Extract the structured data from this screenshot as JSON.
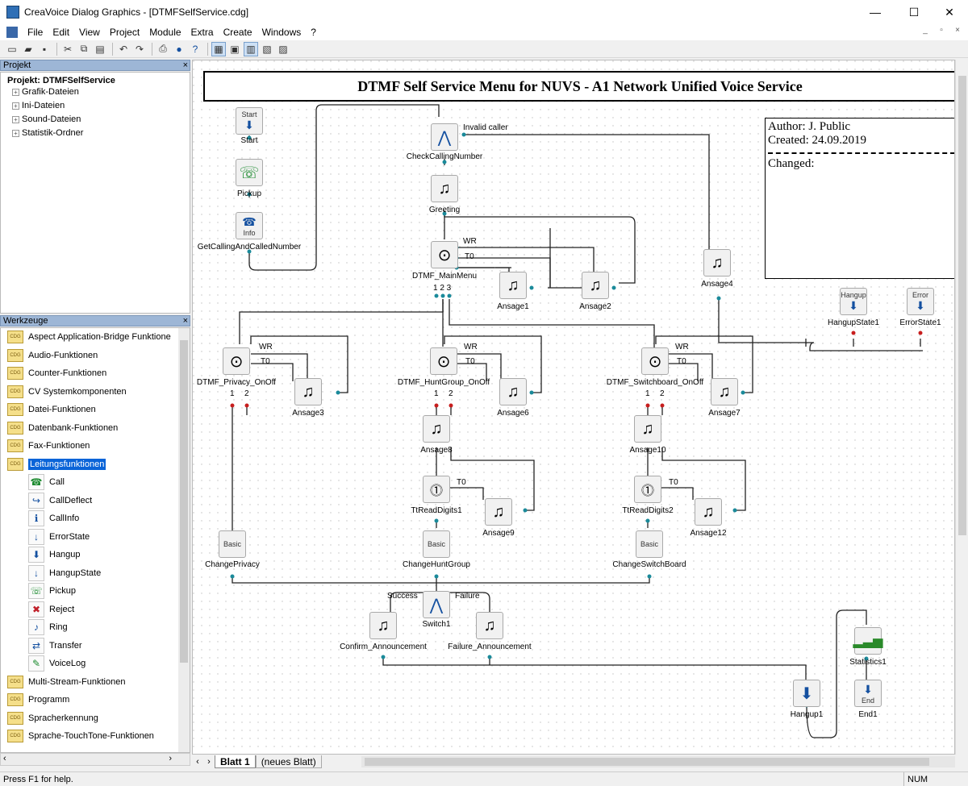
{
  "window": {
    "title": "CreaVoice Dialog Graphics - [DTMFSelfService.cdg]",
    "controls": [
      "—",
      "☐",
      "✕"
    ]
  },
  "menu": [
    "File",
    "Edit",
    "View",
    "Project",
    "Module",
    "Extra",
    "Create",
    "Windows",
    "?"
  ],
  "project_pane": {
    "title": "Projekt",
    "root": "Projekt: DTMFSelfService",
    "items": [
      "Grafik-Dateien",
      "Ini-Dateien",
      "Sound-Dateien",
      "Statistik-Ordner"
    ]
  },
  "tools_pane": {
    "title": "Werkzeuge",
    "groups_top": [
      "Aspect Application-Bridge Funktione",
      "Audio-Funktionen",
      "Counter-Funktionen",
      "CV Systemkomponenten",
      "Datei-Funktionen",
      "Datenbank-Funktionen",
      "Fax-Funktionen"
    ],
    "selected_group": "Leitungsfunktionen",
    "sub_items": [
      {
        "label": "Call",
        "icon": "call-icon"
      },
      {
        "label": "CallDeflect",
        "icon": "call-deflect-icon"
      },
      {
        "label": "CallInfo",
        "icon": "call-info-icon"
      },
      {
        "label": "ErrorState",
        "icon": "error-state-icon"
      },
      {
        "label": "Hangup",
        "icon": "hangup-icon"
      },
      {
        "label": "HangupState",
        "icon": "hangup-state-icon"
      },
      {
        "label": "Pickup",
        "icon": "pickup-icon"
      },
      {
        "label": "Reject",
        "icon": "reject-icon"
      },
      {
        "label": "Ring",
        "icon": "ring-icon"
      },
      {
        "label": "Transfer",
        "icon": "transfer-icon"
      },
      {
        "label": "VoiceLog",
        "icon": "voicelog-icon"
      }
    ],
    "groups_bottom": [
      "Multi-Stream-Funktionen",
      "Programm",
      "Spracherkennung",
      "Sprache-TouchTone-Funktionen"
    ]
  },
  "canvas": {
    "title": "DTMF Self Service Menu for NUVS - A1 Network Unified Voice Service",
    "author_line": "Author: J. Public",
    "created_line": "Created: 24.09.2019",
    "changed_line": "Changed:",
    "nodes": [
      {
        "id": "start",
        "label": "Start",
        "icon": "Start"
      },
      {
        "id": "pickup",
        "label": "Pickup"
      },
      {
        "id": "getcalling",
        "label": "GetCallingAndCalledNumber",
        "icon": "Info"
      },
      {
        "id": "checkcalling",
        "label": "CheckCallingNumber"
      },
      {
        "id": "greeting",
        "label": "Greeting"
      },
      {
        "id": "mainmenu",
        "label": "DTMF_MainMenu"
      },
      {
        "id": "ansage1",
        "label": "Ansage1"
      },
      {
        "id": "ansage2",
        "label": "Ansage2"
      },
      {
        "id": "ansage4",
        "label": "Ansage4"
      },
      {
        "id": "hangupstate1",
        "label": "HangupState1",
        "icon": "Hangup"
      },
      {
        "id": "errorstate1",
        "label": "ErrorState1",
        "icon": "Error"
      },
      {
        "id": "privacy",
        "label": "DTMF_Privacy_OnOff"
      },
      {
        "id": "ansage3",
        "label": "Ansage3"
      },
      {
        "id": "huntgroup",
        "label": "DTMF_HuntGroup_OnOff"
      },
      {
        "id": "ansage6",
        "label": "Ansage6"
      },
      {
        "id": "switchboard",
        "label": "DTMF_Switchboard_OnOff"
      },
      {
        "id": "ansage7",
        "label": "Ansage7"
      },
      {
        "id": "ansage8",
        "label": "Ansage8"
      },
      {
        "id": "ansage10",
        "label": "Ansage10"
      },
      {
        "id": "ttread1",
        "label": "TtReadDigits1"
      },
      {
        "id": "ansage9",
        "label": "Ansage9"
      },
      {
        "id": "ttread2",
        "label": "TtReadDigits2"
      },
      {
        "id": "ansage12",
        "label": "Ansage12"
      },
      {
        "id": "changeprivacy",
        "label": "ChangePrivacy",
        "icon": "Basic"
      },
      {
        "id": "changehunt",
        "label": "ChangeHuntGroup",
        "icon": "Basic"
      },
      {
        "id": "changeswitch",
        "label": "ChangeSwitchBoard",
        "icon": "Basic"
      },
      {
        "id": "switch1",
        "label": "Switch1"
      },
      {
        "id": "confirm",
        "label": "Confirm_Announcement"
      },
      {
        "id": "failure",
        "label": "Failure_Announcement"
      },
      {
        "id": "statistics1",
        "label": "Statistics1"
      },
      {
        "id": "hangup1",
        "label": "Hangup1"
      },
      {
        "id": "end1",
        "label": "End1",
        "icon": "End"
      }
    ],
    "port_labels": {
      "invalid_caller": "Invalid caller",
      "wr": "WR",
      "t0": "T0",
      "main_digits": "1 2 3",
      "one": "1",
      "two": "2",
      "success": "Success",
      "failure": "Failure"
    }
  },
  "tabs": {
    "active": "Blatt 1",
    "new": "(neues Blatt)"
  },
  "status": {
    "help": "Press F1 for help.",
    "num": "NUM"
  }
}
